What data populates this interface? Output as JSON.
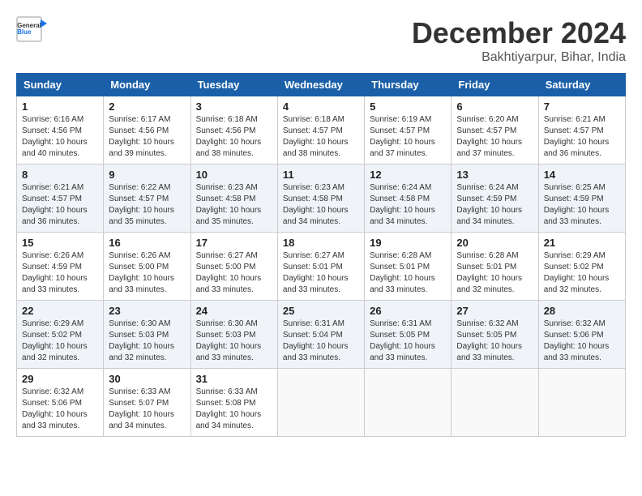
{
  "header": {
    "logo_line1": "General",
    "logo_line2": "Blue",
    "month": "December 2024",
    "location": "Bakhtiyarpur, Bihar, India"
  },
  "weekdays": [
    "Sunday",
    "Monday",
    "Tuesday",
    "Wednesday",
    "Thursday",
    "Friday",
    "Saturday"
  ],
  "weeks": [
    [
      {
        "day": "1",
        "sunrise": "6:16 AM",
        "sunset": "4:56 PM",
        "daylight": "10 hours and 40 minutes."
      },
      {
        "day": "2",
        "sunrise": "6:17 AM",
        "sunset": "4:56 PM",
        "daylight": "10 hours and 39 minutes."
      },
      {
        "day": "3",
        "sunrise": "6:18 AM",
        "sunset": "4:56 PM",
        "daylight": "10 hours and 38 minutes."
      },
      {
        "day": "4",
        "sunrise": "6:18 AM",
        "sunset": "4:57 PM",
        "daylight": "10 hours and 38 minutes."
      },
      {
        "day": "5",
        "sunrise": "6:19 AM",
        "sunset": "4:57 PM",
        "daylight": "10 hours and 37 minutes."
      },
      {
        "day": "6",
        "sunrise": "6:20 AM",
        "sunset": "4:57 PM",
        "daylight": "10 hours and 37 minutes."
      },
      {
        "day": "7",
        "sunrise": "6:21 AM",
        "sunset": "4:57 PM",
        "daylight": "10 hours and 36 minutes."
      }
    ],
    [
      {
        "day": "8",
        "sunrise": "6:21 AM",
        "sunset": "4:57 PM",
        "daylight": "10 hours and 36 minutes."
      },
      {
        "day": "9",
        "sunrise": "6:22 AM",
        "sunset": "4:57 PM",
        "daylight": "10 hours and 35 minutes."
      },
      {
        "day": "10",
        "sunrise": "6:23 AM",
        "sunset": "4:58 PM",
        "daylight": "10 hours and 35 minutes."
      },
      {
        "day": "11",
        "sunrise": "6:23 AM",
        "sunset": "4:58 PM",
        "daylight": "10 hours and 34 minutes."
      },
      {
        "day": "12",
        "sunrise": "6:24 AM",
        "sunset": "4:58 PM",
        "daylight": "10 hours and 34 minutes."
      },
      {
        "day": "13",
        "sunrise": "6:24 AM",
        "sunset": "4:59 PM",
        "daylight": "10 hours and 34 minutes."
      },
      {
        "day": "14",
        "sunrise": "6:25 AM",
        "sunset": "4:59 PM",
        "daylight": "10 hours and 33 minutes."
      }
    ],
    [
      {
        "day": "15",
        "sunrise": "6:26 AM",
        "sunset": "4:59 PM",
        "daylight": "10 hours and 33 minutes."
      },
      {
        "day": "16",
        "sunrise": "6:26 AM",
        "sunset": "5:00 PM",
        "daylight": "10 hours and 33 minutes."
      },
      {
        "day": "17",
        "sunrise": "6:27 AM",
        "sunset": "5:00 PM",
        "daylight": "10 hours and 33 minutes."
      },
      {
        "day": "18",
        "sunrise": "6:27 AM",
        "sunset": "5:01 PM",
        "daylight": "10 hours and 33 minutes."
      },
      {
        "day": "19",
        "sunrise": "6:28 AM",
        "sunset": "5:01 PM",
        "daylight": "10 hours and 33 minutes."
      },
      {
        "day": "20",
        "sunrise": "6:28 AM",
        "sunset": "5:01 PM",
        "daylight": "10 hours and 32 minutes."
      },
      {
        "day": "21",
        "sunrise": "6:29 AM",
        "sunset": "5:02 PM",
        "daylight": "10 hours and 32 minutes."
      }
    ],
    [
      {
        "day": "22",
        "sunrise": "6:29 AM",
        "sunset": "5:02 PM",
        "daylight": "10 hours and 32 minutes."
      },
      {
        "day": "23",
        "sunrise": "6:30 AM",
        "sunset": "5:03 PM",
        "daylight": "10 hours and 32 minutes."
      },
      {
        "day": "24",
        "sunrise": "6:30 AM",
        "sunset": "5:03 PM",
        "daylight": "10 hours and 33 minutes."
      },
      {
        "day": "25",
        "sunrise": "6:31 AM",
        "sunset": "5:04 PM",
        "daylight": "10 hours and 33 minutes."
      },
      {
        "day": "26",
        "sunrise": "6:31 AM",
        "sunset": "5:05 PM",
        "daylight": "10 hours and 33 minutes."
      },
      {
        "day": "27",
        "sunrise": "6:32 AM",
        "sunset": "5:05 PM",
        "daylight": "10 hours and 33 minutes."
      },
      {
        "day": "28",
        "sunrise": "6:32 AM",
        "sunset": "5:06 PM",
        "daylight": "10 hours and 33 minutes."
      }
    ],
    [
      {
        "day": "29",
        "sunrise": "6:32 AM",
        "sunset": "5:06 PM",
        "daylight": "10 hours and 33 minutes."
      },
      {
        "day": "30",
        "sunrise": "6:33 AM",
        "sunset": "5:07 PM",
        "daylight": "10 hours and 34 minutes."
      },
      {
        "day": "31",
        "sunrise": "6:33 AM",
        "sunset": "5:08 PM",
        "daylight": "10 hours and 34 minutes."
      },
      null,
      null,
      null,
      null
    ]
  ]
}
